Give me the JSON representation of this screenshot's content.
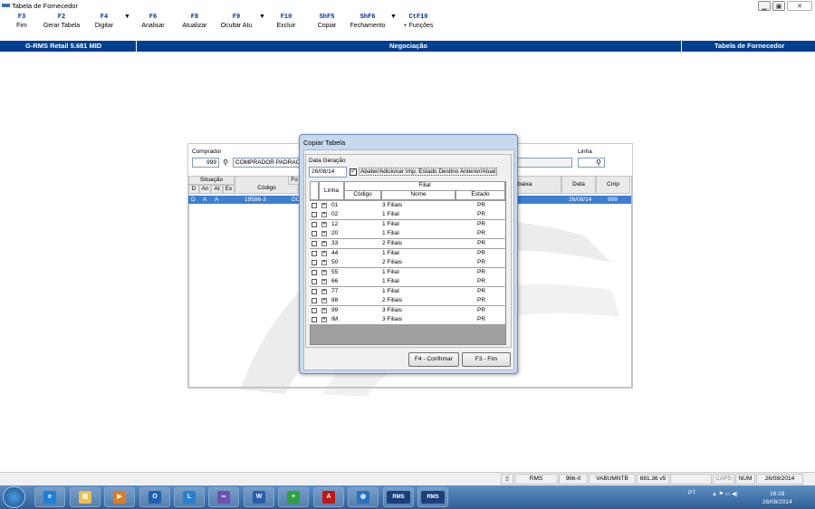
{
  "window": {
    "title": "Tabela de Fornecedor",
    "minimize": "▁",
    "maximize": "▣",
    "close": "✕"
  },
  "toolbar": [
    {
      "key": "F3",
      "label": "Fim"
    },
    {
      "key": "F2",
      "label": "Gerar Tabela"
    },
    {
      "key": "F4",
      "label": "Digitar",
      "dropdown": "▼"
    },
    {
      "key": "F6",
      "label": "Analisar"
    },
    {
      "key": "F8",
      "label": "Atualizar"
    },
    {
      "key": "F9",
      "label": "Ocultar Atu",
      "dropdown": "▼"
    },
    {
      "key": "F10",
      "label": "Excluir"
    },
    {
      "key": "ShF5",
      "label": "Copiar"
    },
    {
      "key": "ShF6",
      "label": "Fechamento",
      "dropdown": "▼"
    },
    {
      "key": "CtF10",
      "label": "+ Funções"
    }
  ],
  "band": {
    "left": "G-RMS Retail 5.681 MID",
    "center": "Negociação",
    "right": "Tabela de Fornecedor"
  },
  "panel": {
    "comprador_label": "Comprador",
    "comprador_code": "999",
    "comprador_name": "COMPRADOR PADRAO",
    "linha_label": "Linha",
    "grid_headers": {
      "situacao": "Situação",
      "d": "D",
      "an": "An",
      "at": "At",
      "ex": "Ex",
      "codigo": "Código",
      "fornecedor_partial": "Fo",
      "baixa_partial": "baixa",
      "data": "Data",
      "cmp": "Cmp"
    },
    "selected_row": {
      "d": "D",
      "an": "A",
      "at": "A",
      "codigo": "19586-3",
      "fornecedor": "DOCES AI",
      "data": "26/08/14",
      "cmp": "999"
    }
  },
  "dialog": {
    "title": "Copiar Tabela",
    "data_geracao_label": "Data Geração",
    "data_geracao": "26/08/14",
    "check_mark": "✓",
    "check_label": "Abater/Adicionar Imp. Estado Destino Anterior/Atual",
    "headers": {
      "linha": "Linha",
      "filial": "Filial",
      "codigo": "Código",
      "nome": "Nome",
      "estado": "Estado"
    },
    "rows": [
      {
        "linha": "01",
        "nome": "3 Filiais",
        "estado": "PR"
      },
      {
        "linha": "02",
        "nome": "1 Filial",
        "estado": "PR"
      },
      {
        "linha": "12",
        "nome": "1 Filial",
        "estado": "PR"
      },
      {
        "linha": "20",
        "nome": "1 Filial",
        "estado": "PR"
      },
      {
        "linha": "33",
        "nome": "2 Filiais",
        "estado": "PR"
      },
      {
        "linha": "44",
        "nome": "1 Filial",
        "estado": "PR"
      },
      {
        "linha": "50",
        "nome": "2 Filiais",
        "estado": "PR"
      },
      {
        "linha": "55",
        "nome": "1 Filial",
        "estado": "PR"
      },
      {
        "linha": "66",
        "nome": "1 Filial",
        "estado": "PR"
      },
      {
        "linha": "77",
        "nome": "1 Filial",
        "estado": "PR"
      },
      {
        "linha": "88",
        "nome": "2 Filiais",
        "estado": "PR"
      },
      {
        "linha": "99",
        "nome": "3 Filiais",
        "estado": "PR"
      },
      {
        "linha": "IM",
        "nome": "3 Filiais",
        "estado": "PR"
      }
    ],
    "expand_glyph": "+",
    "confirm_button": "F4 - Confirmar",
    "fim_button": "F3 - Fim"
  },
  "statusbar": {
    "rms": "RMS",
    "code": "966-0",
    "user": "VABUMNTB",
    "version": "681.36 v5",
    "caps": "CAPS",
    "num": "NUM",
    "date": "26/08/2014"
  },
  "taskbar": {
    "apps": [
      {
        "icon": "internet-explorer-icon",
        "glyph": "e",
        "color": "#1e7fd6"
      },
      {
        "icon": "file-explorer-icon",
        "glyph": "▤",
        "color": "#e8c050"
      },
      {
        "icon": "media-player-icon",
        "glyph": "▶",
        "color": "#e07a20"
      },
      {
        "icon": "outlook-icon",
        "glyph": "O",
        "color": "#1f5fb0"
      },
      {
        "icon": "lync-icon",
        "glyph": "L",
        "color": "#2a7fd0"
      },
      {
        "icon": "connector-icon",
        "glyph": "∞",
        "color": "#7050b0"
      },
      {
        "icon": "word-icon",
        "glyph": "W",
        "color": "#2b5caa"
      },
      {
        "icon": "plus-tool-icon",
        "glyph": "+",
        "color": "#30a040"
      },
      {
        "icon": "pdf-reader-icon",
        "glyph": "A",
        "color": "#c01818"
      },
      {
        "icon": "globe-icon",
        "glyph": "◍",
        "color": "#2a6fc0"
      },
      {
        "icon": "rms-app-icon",
        "glyph": "RMS",
        "color": "#1a3f7a"
      },
      {
        "icon": "rms-app-icon-2",
        "glyph": "RMS",
        "color": "#1a3f7a"
      }
    ],
    "lang": "PT",
    "time": "16:18",
    "date": "26/08/2014"
  }
}
